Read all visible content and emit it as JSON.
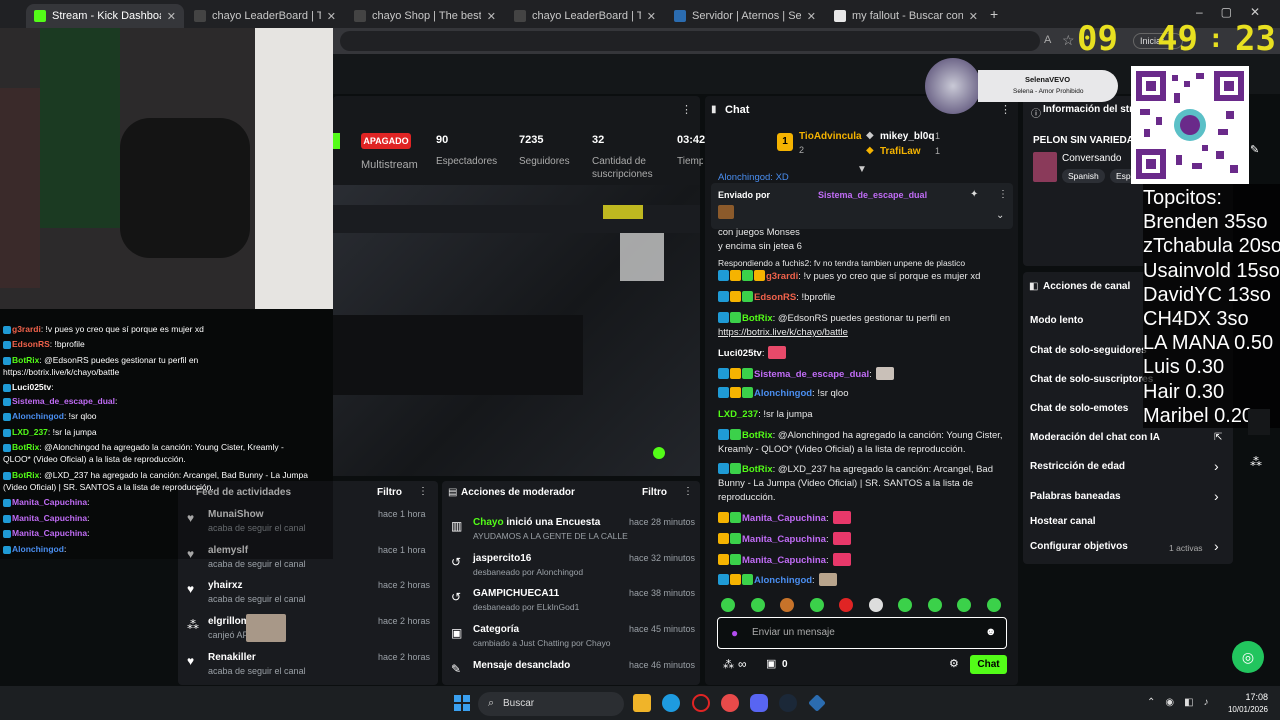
{
  "browser": {
    "tabs": [
      {
        "title": "Stream - Kick Dashboard",
        "color": "#53fc18",
        "active": true
      },
      {
        "title": "chayo LeaderBoard | The best Cha",
        "color": "#444"
      },
      {
        "title": "chayo Shop | The best ChatBot an",
        "color": "#444"
      },
      {
        "title": "chayo LeaderBoard | The best Cha",
        "color": "#444"
      },
      {
        "title": "Servidor | Aternos | Servidor de Mi",
        "color": "#2b6cb0"
      },
      {
        "title": "my fallout - Buscar con Google",
        "color": "#e8e8e8"
      }
    ],
    "new_tab": "+",
    "iniciar": "Iniciar"
  },
  "clock": {
    "h": "09",
    "m": "49",
    "s": "23",
    "sep": ":"
  },
  "stream_stats": {
    "status_badge": "APAGADO",
    "multistream": "Multistream",
    "viewers": "90",
    "viewers_label": "Espectadores",
    "followers": "7235",
    "followers_label": "Seguidores",
    "subs": "32",
    "subs_label": "Cantidad de suscripciones",
    "time": "03:42",
    "time_label": "Tiempo en vivo"
  },
  "now_playing": {
    "title": "SelenaVEVO",
    "subtitle": "Selena - Amor Prohibido"
  },
  "chat": {
    "title": "Chat",
    "leaders": [
      {
        "rank": "1",
        "name": "TioAdvincula",
        "count": "2"
      },
      {
        "name": "mikey_bl0q",
        "count": "1"
      },
      {
        "name": "TrafiLaw",
        "count": "1"
      }
    ],
    "pinned_by": "Enviado por",
    "pinned_user": "Sistema_de_escape_dual",
    "truncated_top": "Alonchingod: XD",
    "line1": "y encima sin jetea 6",
    "line1a": "con juegos Monses",
    "reply_to": "Respondiendo a fuchis2: fv no tendra tambien unpene de plastico",
    "messages": [
      {
        "user": "g3rardi",
        "text": ": !v pues yo creo que sí porque es mujer xd",
        "color": "#f0624b"
      },
      {
        "user": "EdsonRS",
        "text": ": !bprofile",
        "color": "#f0624b"
      },
      {
        "user": "BotRix",
        "text": ": @EdsonRS puedes gestionar tu perfil en",
        "color": "#53fc18"
      },
      {
        "user": "",
        "text": "https://botrix.live/k/chayo/battle",
        "color": "#fff"
      },
      {
        "user": "Luci025tv",
        "text": ":",
        "color": "#fff"
      },
      {
        "user": "Sistema_de_escape_dual",
        "text": ":",
        "color": "#c06cf5"
      },
      {
        "user": "Alonchingod",
        "text": ": !sr qloo",
        "color": "#4a8ef0"
      },
      {
        "user": "LXD_237",
        "text": ": !sr la jumpa",
        "color": "#53fc18"
      },
      {
        "user": "BotRix",
        "text": ": @Alonchingod ha agregado la canción: Young Cister,",
        "color": "#53fc18"
      },
      {
        "user": "",
        "text": "Kreamly - QLOO* (Video Oficial) a la lista de reproducción.",
        "color": "#fff"
      },
      {
        "user": "BotRix",
        "text": ": @LXD_237 ha agregado la canción: Arcangel, Bad",
        "color": "#53fc18"
      },
      {
        "user": "",
        "text": "Bunny - La Jumpa (Video Oficial) | SR. SANTOS a la lista de",
        "color": "#fff"
      },
      {
        "user": "",
        "text": "reproducción.",
        "color": "#fff"
      },
      {
        "user": "Manita_Capuchina",
        "text": ":",
        "color": "#c06cf5"
      },
      {
        "user": "Manita_Capuchina",
        "text": ":",
        "color": "#c06cf5"
      },
      {
        "user": "Manita_Capuchina",
        "text": ":",
        "color": "#c06cf5"
      },
      {
        "user": "Alonchingod",
        "text": ":",
        "color": "#4a8ef0"
      }
    ],
    "input_placeholder": "Enviar un mensaje",
    "points": "0",
    "send": "Chat"
  },
  "info": {
    "title": "Información del stre",
    "stream_title": "PELON SIN VARIEDAD",
    "category": "Conversando",
    "tags": [
      "Spanish",
      "Espa"
    ]
  },
  "channel_actions": {
    "title": "Acciones de canal",
    "items": [
      {
        "label": "Modo lento"
      },
      {
        "label": "Chat de solo-seguidores"
      },
      {
        "label": "Chat de solo-suscriptores"
      },
      {
        "label": "Chat de solo-emotes"
      },
      {
        "label": "Moderación del chat con IA"
      },
      {
        "label": "Restricción de edad"
      },
      {
        "label": "Palabras baneadas"
      },
      {
        "label": "Hostear canal"
      },
      {
        "label": "Configurar objetivos"
      }
    ],
    "goals_active": "1 activas"
  },
  "topcitos": [
    "Topcitos:",
    "Brenden 35so",
    "zTchabula 20so",
    "Usainvold 15so",
    "DavidYC 13so",
    "CH4DX 3so",
    "LA MANA 0.50",
    "Luis 0.30",
    "Hair 0.30",
    "Maribel 0.20"
  ],
  "feed": {
    "title": "Feed de actividades",
    "filter": "Filtro",
    "items": [
      {
        "user": "MunaiShow",
        "action": "acaba de seguir el canal",
        "time": "hace 1 hora"
      },
      {
        "user": "alemyslf",
        "action": "acaba de seguir el canal",
        "time": "hace 1 hora"
      },
      {
        "user": "yhairxz",
        "action": "acaba de seguir el canal",
        "time": "hace 2 horas"
      },
      {
        "user": "elgrillom",
        "action": "canjeó AP",
        "time": "hace 2 horas"
      },
      {
        "user": "Renakiller",
        "action": "acaba de seguir el canal",
        "time": "hace 2 horas"
      }
    ]
  },
  "modactions": {
    "title": "Acciones de moderador",
    "filter": "Filtro",
    "items": [
      {
        "head": "Chayo",
        "headrest": " inició una Encuesta",
        "sub": "AYUDAMOS A LA GENTE DE LA CALLE",
        "time": "hace 28 minutos"
      },
      {
        "head": "jaspercito16",
        "headrest": "",
        "sub": "desbaneado por Alonchingod",
        "time": "hace 32 minutos"
      },
      {
        "head": "GAMPICHUECA11",
        "headrest": "",
        "sub": "desbaneado por ELkInGod1",
        "time": "hace 38 minutos"
      },
      {
        "head": "Categoría",
        "headrest": "",
        "sub": "cambiado a Just Chatting por Chayo",
        "time": "hace 45 minutos"
      },
      {
        "head": "Mensaje desanclado",
        "headrest": "",
        "sub": "",
        "time": "hace 46 minutos"
      }
    ]
  },
  "overlay_chat": [
    {
      "user": "g3rardi",
      "text": ": !v pues yo creo que sí porque es mujer xd",
      "color": "#f0624b"
    },
    {
      "user": "EdsonRS",
      "text": ": !bprofile",
      "color": "#f0624b"
    },
    {
      "user": "BotRix",
      "text": ": @EdsonRS puedes gestionar tu perfil en",
      "color": "#53fc18"
    },
    {
      "user": "",
      "text": "https://botrix.live/k/chayo/battle",
      "color": "#fff"
    },
    {
      "user": "Luci025tv",
      "text": ":",
      "color": "#fff"
    },
    {
      "user": "Sistema_de_escape_dual",
      "text": ":",
      "color": "#c06cf5"
    },
    {
      "user": "Alonchingod",
      "text": ": !sr qloo",
      "color": "#4a8ef0"
    },
    {
      "user": "LXD_237",
      "text": ": !sr la jumpa",
      "color": "#53fc18"
    },
    {
      "user": "BotRix",
      "text": ": @Alonchingod ha agregado la canción: Young Cister, Kreamly -",
      "color": "#53fc18"
    },
    {
      "user": "",
      "text": "QLOO* (Video Oficial) a la lista de reproducción.",
      "color": "#fff"
    },
    {
      "user": "BotRix",
      "text": ": @LXD_237 ha agregado la canción: Arcangel, Bad Bunny - La Jumpa",
      "color": "#53fc18"
    },
    {
      "user": "",
      "text": "(Video Oficial) | SR. SANTOS a la lista de reproducción.",
      "color": "#fff"
    },
    {
      "user": "Manita_Capuchina",
      "text": ":",
      "color": "#c06cf5"
    },
    {
      "user": "Manita_Capuchina",
      "text": ":",
      "color": "#c06cf5"
    },
    {
      "user": "Manita_Capuchina",
      "text": ":",
      "color": "#c06cf5"
    },
    {
      "user": "Alonchingod",
      "text": ":",
      "color": "#4a8ef0"
    }
  ],
  "taskbar": {
    "search": "Buscar",
    "time": "17:08",
    "date": "10/01/2026"
  }
}
